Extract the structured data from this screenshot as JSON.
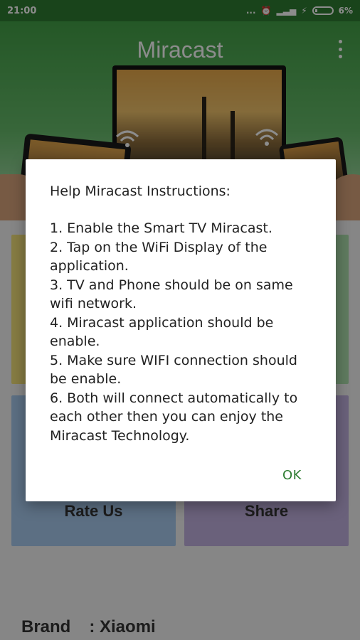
{
  "status_bar": {
    "time": "21:00",
    "dots": "...",
    "battery": "6%"
  },
  "app": {
    "title": "Miracast",
    "tiles": [
      {
        "label": "",
        "color": "#f4e27a"
      },
      {
        "label": "",
        "color": "#aee0ad"
      },
      {
        "label": "Rate Us",
        "color": "#a8cbee"
      },
      {
        "label": "Share",
        "color": "#c2b1e0"
      }
    ],
    "brand": {
      "label": "Brand",
      "value": ": Xiaomi"
    }
  },
  "dialog": {
    "title": "Help Miracast Instructions:",
    "steps": [
      "1. Enable the Smart TV Miracast.",
      "2. Tap on the WiFi Display of the application.",
      "3. TV and Phone should be on same wifi network.",
      "4. Miracast application should be enable.",
      "5. Make sure WIFI connection should be enable.",
      "6. Both will connect automatically to each other then you can enjoy the Miracast Technology."
    ],
    "ok_label": "OK"
  },
  "colors": {
    "accent": "#2e7d32",
    "header": "#43a047"
  }
}
